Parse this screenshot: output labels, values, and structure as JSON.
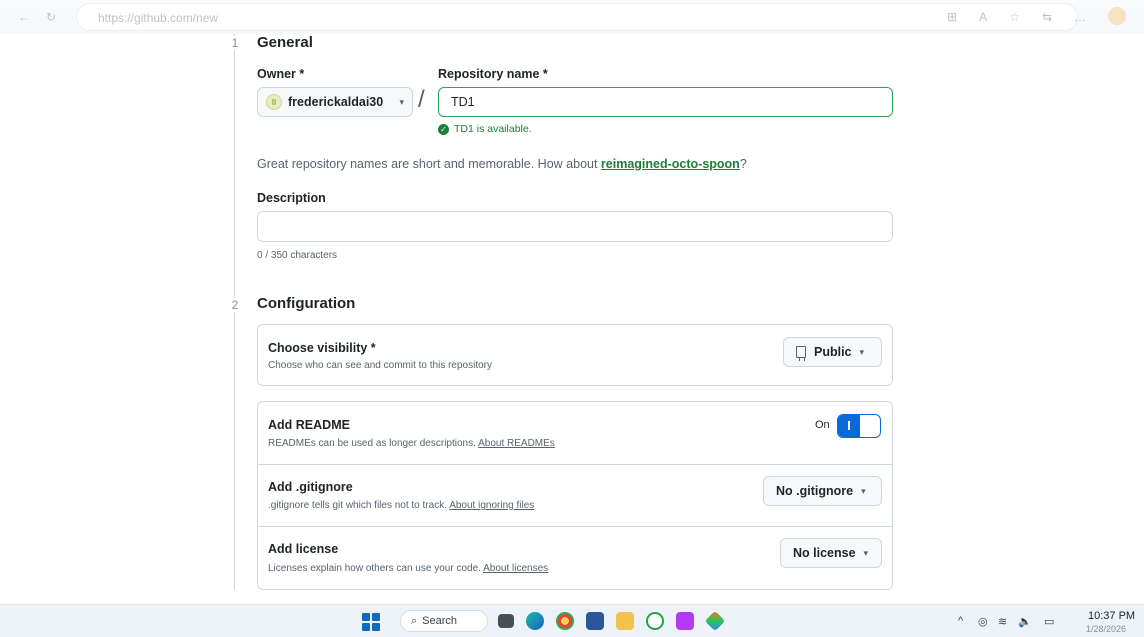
{
  "browser": {
    "url": "https://github.com/new",
    "back_glyph": "←",
    "reload_glyph": "↻",
    "right_glyphs": [
      "⊞",
      "A",
      "☆",
      "⇆",
      "…"
    ]
  },
  "steps": {
    "general_num": "1",
    "general_title": "General",
    "config_num": "2",
    "config_title": "Configuration"
  },
  "owner": {
    "label": "Owner *",
    "avatar_glyph": "II",
    "name": "frederickaldai30",
    "caret": "▾"
  },
  "separator": "/",
  "repository": {
    "label": "Repository name *",
    "value": "TD1",
    "availability": "TD1 is available.",
    "check_glyph": "✓"
  },
  "suggestion": {
    "prefix": "Great repository names are short and memorable. How about ",
    "name": "reimagined-octo-spoon",
    "suffix": "?"
  },
  "description": {
    "label": "Description",
    "value": "",
    "char_count": "0 / 350 characters"
  },
  "visibility": {
    "title": "Choose visibility *",
    "desc": "Choose who can see and commit to this repository",
    "selected": "Public",
    "caret": "▾"
  },
  "readme": {
    "title": "Add README",
    "desc": "READMEs can be used as longer descriptions. ",
    "link": "About READMEs",
    "toggle_state": "On"
  },
  "gitignore": {
    "title": "Add .gitignore",
    "desc": ".gitignore tells git which files not to track. ",
    "link": "About ignoring files",
    "selected": "No .gitignore",
    "caret": "▾"
  },
  "license": {
    "title": "Add license",
    "desc": "Licenses explain how others can use your code. ",
    "link": "About licenses",
    "selected": "No license",
    "caret": "▾"
  },
  "taskbar": {
    "search_glyph": "⌕",
    "search_label": "Search",
    "tray_glyphs": [
      "^",
      "◎",
      "≋",
      "🔈",
      "▭"
    ],
    "time": "10:37 PM",
    "date": "1/28/2026"
  },
  "colors": {
    "accent_blue": "#0969da",
    "success_green": "#1a7f37",
    "border": "#d0d7de"
  }
}
